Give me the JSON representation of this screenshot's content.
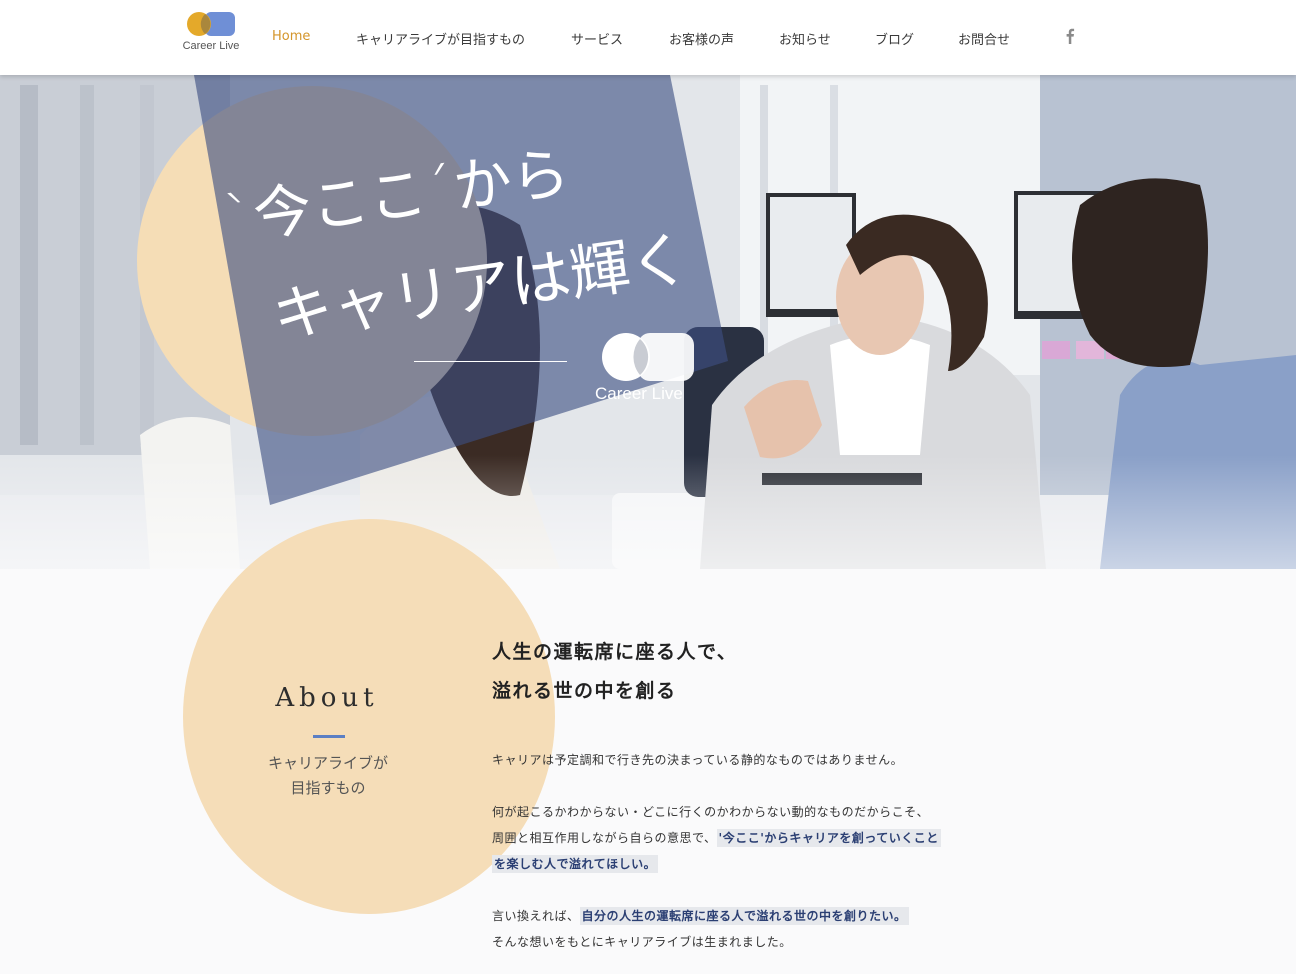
{
  "header": {
    "logo_text": "Career Live",
    "nav": [
      {
        "label": "Home",
        "active": true
      },
      {
        "label": "キャリアライブが目指すもの",
        "active": false
      },
      {
        "label": "サービス",
        "active": false
      },
      {
        "label": "お客様の声",
        "active": false
      },
      {
        "label": "お知らせ",
        "active": false
      },
      {
        "label": "ブログ",
        "active": false
      },
      {
        "label": "お問合せ",
        "active": false
      }
    ],
    "social_icon": "facebook-icon"
  },
  "hero": {
    "headline_line1": "`今ここ´から",
    "headline_line2": "キャリアは輝く",
    "logo_text": "Career Live"
  },
  "about": {
    "title": "About",
    "subtitle_line1": "キャリアライブが",
    "subtitle_line2": "目指すもの",
    "headline_line1": "人生の運転席に座る人で、",
    "headline_line2": "溢れる世の中を創る",
    "p1": "キャリアは予定調和で行き先の決まっている静的なものではありません。",
    "p2_line1": "何が起こるかわからない・どこに行くのかわからない動的なものだからこそ、",
    "p2_line2_plain": "周囲と相互作用しながら自らの意思で、",
    "p2_line2_hl": "'今ここ'からキャリアを創っていくこと",
    "p2_line3_hl": "を楽しむ人で溢れてほしい。",
    "p3_line1_plain": "言い換えれば、",
    "p3_line1_hl": "自分の人生の運転席に座る人で溢れる世の中を創りたい。",
    "p3_line2": "そんな想いをもとにキャリアライブは生まれました。"
  },
  "colors": {
    "accent_orange": "#d4952a",
    "circle_peach": "#f5ddb6",
    "hero_navy": "#3d4f82",
    "underline_blue": "#5b7fc4",
    "highlight_text": "#2b3f73"
  }
}
